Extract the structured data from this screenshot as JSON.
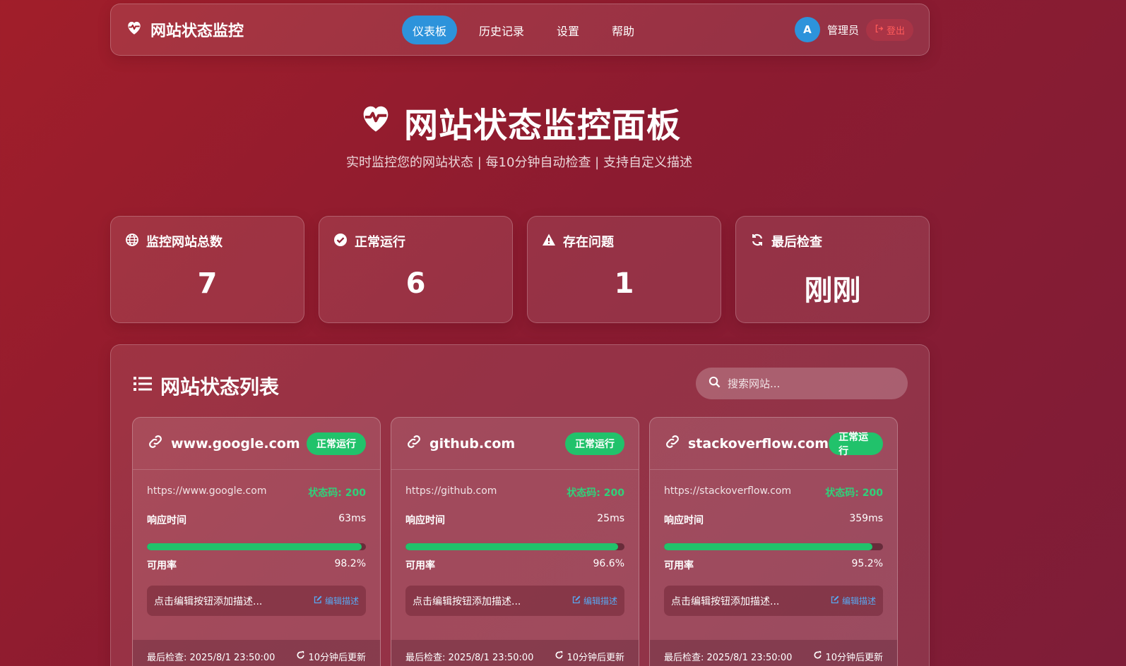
{
  "nav": {
    "brand": "网站状态监控",
    "links": [
      "仪表板",
      "历史记录",
      "设置",
      "帮助"
    ],
    "user_initial": "A",
    "user_name": "管理员",
    "logout": "登出"
  },
  "hero": {
    "title": "网站状态监控面板",
    "subtitle": "实时监控您的网站状态 | 每10分钟自动检查 | 支持自定义描述"
  },
  "stats": [
    {
      "icon": "globe-icon",
      "label": "监控网站总数",
      "value": "7"
    },
    {
      "icon": "check-circle-icon",
      "label": "正常运行",
      "value": "6"
    },
    {
      "icon": "warning-icon",
      "label": "存在问题",
      "value": "1"
    },
    {
      "icon": "refresh-icon",
      "label": "最后检查",
      "value": "刚刚"
    }
  ],
  "list": {
    "title": "网站状态列表",
    "search_placeholder": "搜索网站..."
  },
  "sites": [
    {
      "name": "www.google.com",
      "status": "正常运行",
      "url": "https://www.google.com",
      "code": "状态码: 200",
      "response_label": "响应时间",
      "response": "63ms",
      "response_bar": 0.98,
      "uptime_label": "可用率",
      "uptime": "98.2%",
      "description": "点击编辑按钮添加描述...",
      "edit": "编辑描述",
      "last_check": "最后检查: 2025/8/1 23:50:00",
      "next_update": "10分钟后更新"
    },
    {
      "name": "github.com",
      "status": "正常运行",
      "url": "https://github.com",
      "code": "状态码: 200",
      "response_label": "响应时间",
      "response": "25ms",
      "response_bar": 0.97,
      "uptime_label": "可用率",
      "uptime": "96.6%",
      "description": "点击编辑按钮添加描述...",
      "edit": "编辑描述",
      "last_check": "最后检查: 2025/8/1 23:50:00",
      "next_update": "10分钟后更新"
    },
    {
      "name": "stackoverflow.com",
      "status": "正常运行",
      "url": "https://stackoverflow.com",
      "code": "状态码: 200",
      "response_label": "响应时间",
      "response": "359ms",
      "response_bar": 0.95,
      "uptime_label": "可用率",
      "uptime": "95.2%",
      "description": "点击编辑按钮添加描述...",
      "edit": "编辑描述",
      "last_check": "最后检查: 2025/8/1 23:50:00",
      "next_update": "10分钟后更新"
    }
  ],
  "colors": {
    "accent": "#2d93db",
    "success": "#21c26b",
    "danger": "#ff5a5a",
    "background": "#8c1b30"
  }
}
